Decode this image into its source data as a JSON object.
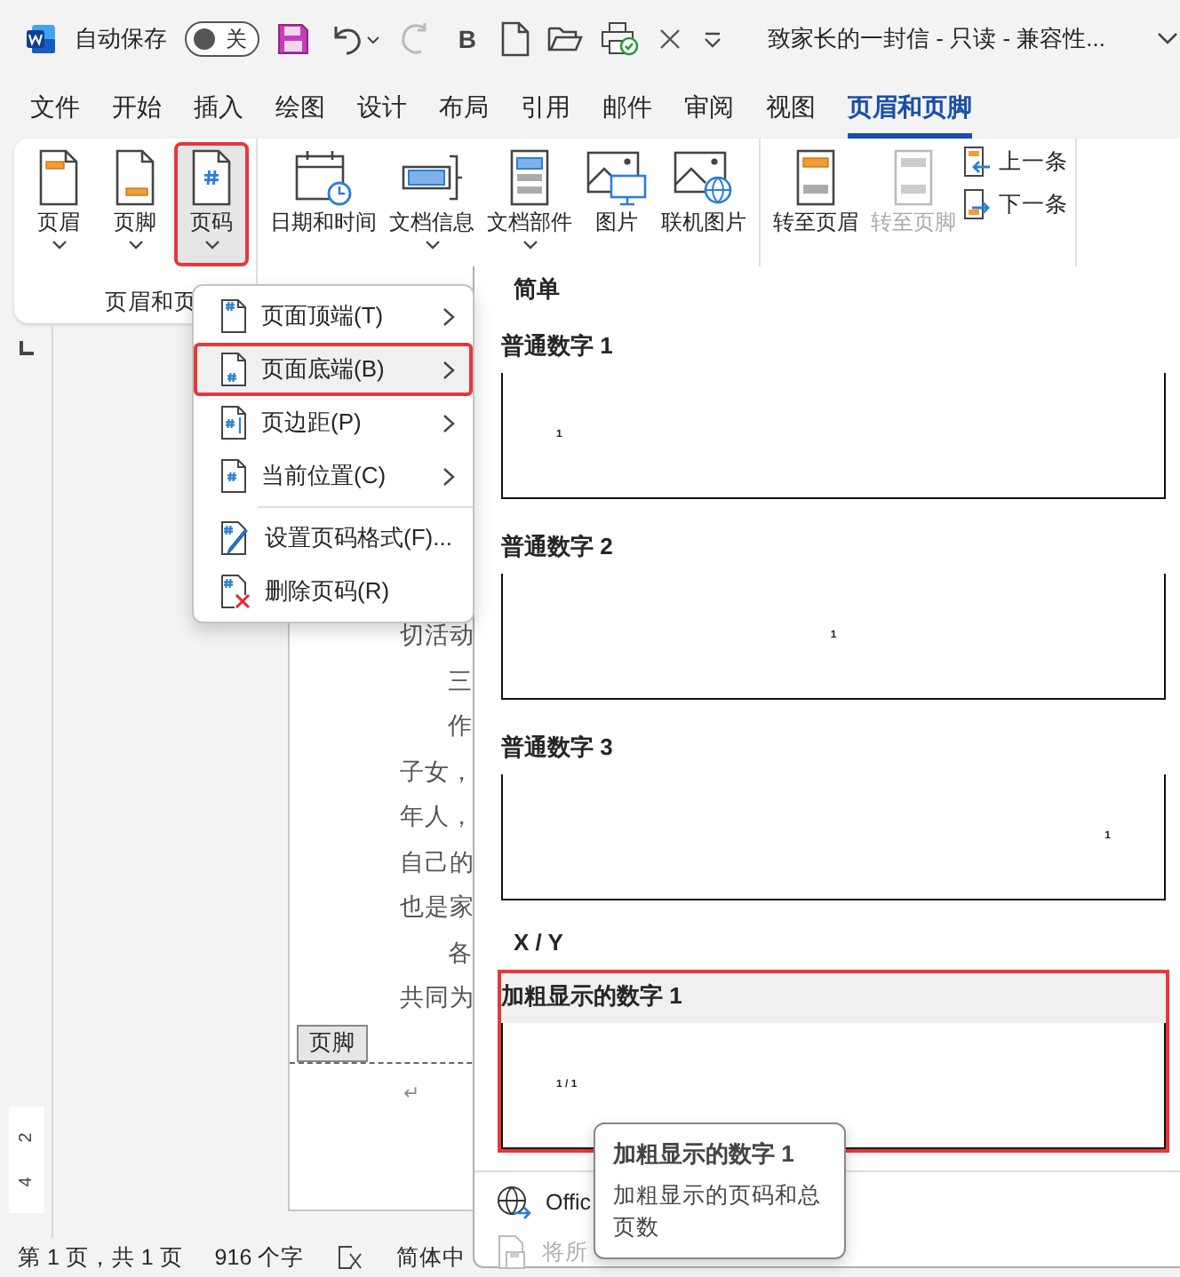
{
  "title_bar": {
    "autosave_label": "自动保存",
    "autosave": {
      "on": false,
      "label": "关"
    },
    "bold_label": "B",
    "document_title": "致家长的一封信  -  只读  -  兼容性..."
  },
  "tabs": [
    {
      "label": "文件",
      "selected": false
    },
    {
      "label": "开始",
      "selected": false
    },
    {
      "label": "插入",
      "selected": false
    },
    {
      "label": "绘图",
      "selected": false
    },
    {
      "label": "设计",
      "selected": false
    },
    {
      "label": "布局",
      "selected": false
    },
    {
      "label": "引用",
      "selected": false
    },
    {
      "label": "邮件",
      "selected": false
    },
    {
      "label": "审阅",
      "selected": false
    },
    {
      "label": "视图",
      "selected": false
    },
    {
      "label": "页眉和页脚",
      "selected": true
    }
  ],
  "ribbon": {
    "groups": [
      {
        "label": "页眉和页",
        "buttons": [
          {
            "kind": "header",
            "label": "页眉",
            "has_menu": true,
            "highlighted": false,
            "disabled": false
          },
          {
            "kind": "footer",
            "label": "页脚",
            "has_menu": true,
            "highlighted": false,
            "disabled": false
          },
          {
            "kind": "page_number",
            "label": "页码",
            "has_menu": true,
            "highlighted": true,
            "disabled": false
          }
        ]
      },
      {
        "buttons": [
          {
            "kind": "date_time",
            "label": "日期和时间",
            "has_menu": false,
            "highlighted": false,
            "disabled": false
          },
          {
            "kind": "document_info",
            "label": "文档信息",
            "has_menu": true,
            "highlighted": false,
            "disabled": false
          },
          {
            "kind": "quick_parts",
            "label": "文档部件",
            "has_menu": true,
            "highlighted": false,
            "disabled": false
          },
          {
            "kind": "picture",
            "label": "图片",
            "has_menu": false,
            "highlighted": false,
            "disabled": false
          },
          {
            "kind": "online_picture",
            "label": "联机图片",
            "has_menu": false,
            "highlighted": false,
            "disabled": false
          }
        ]
      },
      {
        "buttons": [
          {
            "kind": "goto_header",
            "label": "转至页眉",
            "has_menu": false,
            "highlighted": false,
            "disabled": false
          },
          {
            "kind": "goto_footer",
            "label": "转至页脚",
            "has_menu": false,
            "highlighted": false,
            "disabled": true
          }
        ],
        "small_buttons": [
          {
            "kind": "previous",
            "label": "上一条"
          },
          {
            "kind": "next",
            "label": "下一条"
          }
        ]
      }
    ]
  },
  "document": {
    "lines": [
      {
        "text": "切活动",
        "indented": false
      },
      {
        "text": "三",
        "indented": true
      },
      {
        "text": "作",
        "indented": true
      },
      {
        "text": "子女，",
        "indented": false
      },
      {
        "text": "年人，",
        "indented": false
      },
      {
        "text": "自己的",
        "indented": false
      },
      {
        "text": "也是家",
        "indented": false
      },
      {
        "text": "各",
        "indented": true
      },
      {
        "text": "共同为",
        "indented": false
      }
    ],
    "footer_tag": "页脚",
    "paragraph_mark": "↵",
    "ruler_marks": [
      "2",
      "4"
    ]
  },
  "status_bar": {
    "page": "第 1 页，共 1 页",
    "words": "916 个字",
    "language": "简体中"
  },
  "page_number_menu": {
    "groups": [
      {
        "items": [
          {
            "kind": "top",
            "label": "页面顶端(T)",
            "submenu": true,
            "selected": false
          },
          {
            "kind": "bottom",
            "label": "页面底端(B)",
            "submenu": true,
            "selected": true
          },
          {
            "kind": "margin",
            "label": "页边距(P)",
            "submenu": true,
            "selected": false
          },
          {
            "kind": "current",
            "label": "当前位置(C)",
            "submenu": true,
            "selected": false
          }
        ]
      },
      {
        "items": [
          {
            "kind": "format",
            "label": "设置页码格式(F)...",
            "submenu": false,
            "selected": false
          },
          {
            "kind": "remove",
            "label": "删除页码(R)",
            "submenu": false,
            "selected": false
          }
        ]
      }
    ]
  },
  "gallery": {
    "sections": [
      {
        "heading": "简单",
        "items": [
          {
            "label": "普通数字 1",
            "number": "1",
            "kind": "left",
            "selected": false
          },
          {
            "label": "普通数字 2",
            "number": "1",
            "kind": "center",
            "selected": false
          },
          {
            "label": "普通数字 3",
            "number": "1",
            "kind": "right",
            "selected": false
          }
        ]
      },
      {
        "heading": "X / Y",
        "items": [
          {
            "label": "加粗显示的数字 1",
            "number": "1 / 1",
            "kind": "left",
            "selected": true
          }
        ]
      }
    ],
    "footer_items": [
      {
        "kind": "office",
        "label": "Offic",
        "disabled": false
      },
      {
        "kind": "save",
        "label": "将所",
        "disabled": true
      }
    ]
  },
  "tooltip": {
    "title": "加粗显示的数字 1",
    "body": "加粗显示的页码和总页数"
  }
}
